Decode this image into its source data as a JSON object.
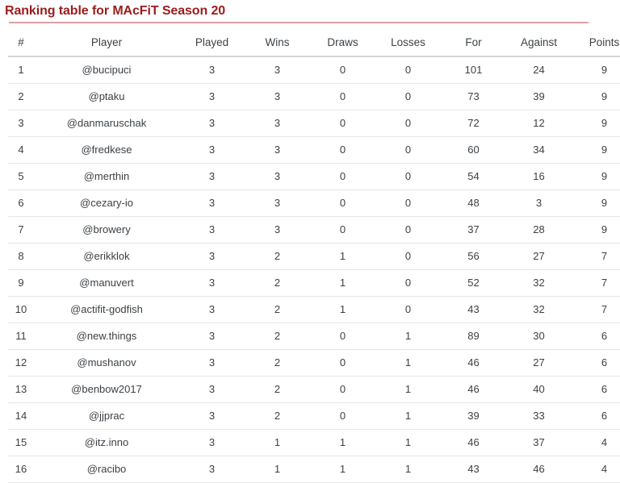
{
  "title": "Ranking table for MAcFiT Season 20",
  "accent_color": "#9b1c1c",
  "rule_color": "#d9a0a0",
  "text_color": "#3c4145",
  "table": {
    "headers": {
      "rank": "#",
      "player": "Player",
      "played": "Played",
      "wins": "Wins",
      "draws": "Draws",
      "losses": "Losses",
      "for": "For",
      "against": "Against",
      "points": "Points"
    },
    "rows": [
      {
        "rank": "1",
        "player": "@bucipuci",
        "played": "3",
        "wins": "3",
        "draws": "0",
        "losses": "0",
        "for": "101",
        "against": "24",
        "points": "9"
      },
      {
        "rank": "2",
        "player": "@ptaku",
        "played": "3",
        "wins": "3",
        "draws": "0",
        "losses": "0",
        "for": "73",
        "against": "39",
        "points": "9"
      },
      {
        "rank": "3",
        "player": "@danmaruschak",
        "played": "3",
        "wins": "3",
        "draws": "0",
        "losses": "0",
        "for": "72",
        "against": "12",
        "points": "9"
      },
      {
        "rank": "4",
        "player": "@fredkese",
        "played": "3",
        "wins": "3",
        "draws": "0",
        "losses": "0",
        "for": "60",
        "against": "34",
        "points": "9"
      },
      {
        "rank": "5",
        "player": "@merthin",
        "played": "3",
        "wins": "3",
        "draws": "0",
        "losses": "0",
        "for": "54",
        "against": "16",
        "points": "9"
      },
      {
        "rank": "6",
        "player": "@cezary-io",
        "played": "3",
        "wins": "3",
        "draws": "0",
        "losses": "0",
        "for": "48",
        "against": "3",
        "points": "9"
      },
      {
        "rank": "7",
        "player": "@browery",
        "played": "3",
        "wins": "3",
        "draws": "0",
        "losses": "0",
        "for": "37",
        "against": "28",
        "points": "9"
      },
      {
        "rank": "8",
        "player": "@erikklok",
        "played": "3",
        "wins": "2",
        "draws": "1",
        "losses": "0",
        "for": "56",
        "against": "27",
        "points": "7"
      },
      {
        "rank": "9",
        "player": "@manuvert",
        "played": "3",
        "wins": "2",
        "draws": "1",
        "losses": "0",
        "for": "52",
        "against": "32",
        "points": "7"
      },
      {
        "rank": "10",
        "player": "@actifit-godfish",
        "played": "3",
        "wins": "2",
        "draws": "1",
        "losses": "0",
        "for": "43",
        "against": "32",
        "points": "7"
      },
      {
        "rank": "11",
        "player": "@new.things",
        "played": "3",
        "wins": "2",
        "draws": "0",
        "losses": "1",
        "for": "89",
        "against": "30",
        "points": "6"
      },
      {
        "rank": "12",
        "player": "@mushanov",
        "played": "3",
        "wins": "2",
        "draws": "0",
        "losses": "1",
        "for": "46",
        "against": "27",
        "points": "6"
      },
      {
        "rank": "13",
        "player": "@benbow2017",
        "played": "3",
        "wins": "2",
        "draws": "0",
        "losses": "1",
        "for": "46",
        "against": "40",
        "points": "6"
      },
      {
        "rank": "14",
        "player": "@jjprac",
        "played": "3",
        "wins": "2",
        "draws": "0",
        "losses": "1",
        "for": "39",
        "against": "33",
        "points": "6"
      },
      {
        "rank": "15",
        "player": "@itz.inno",
        "played": "3",
        "wins": "1",
        "draws": "1",
        "losses": "1",
        "for": "46",
        "against": "37",
        "points": "4"
      },
      {
        "rank": "16",
        "player": "@racibo",
        "played": "3",
        "wins": "1",
        "draws": "1",
        "losses": "1",
        "for": "43",
        "against": "46",
        "points": "4"
      }
    ]
  }
}
